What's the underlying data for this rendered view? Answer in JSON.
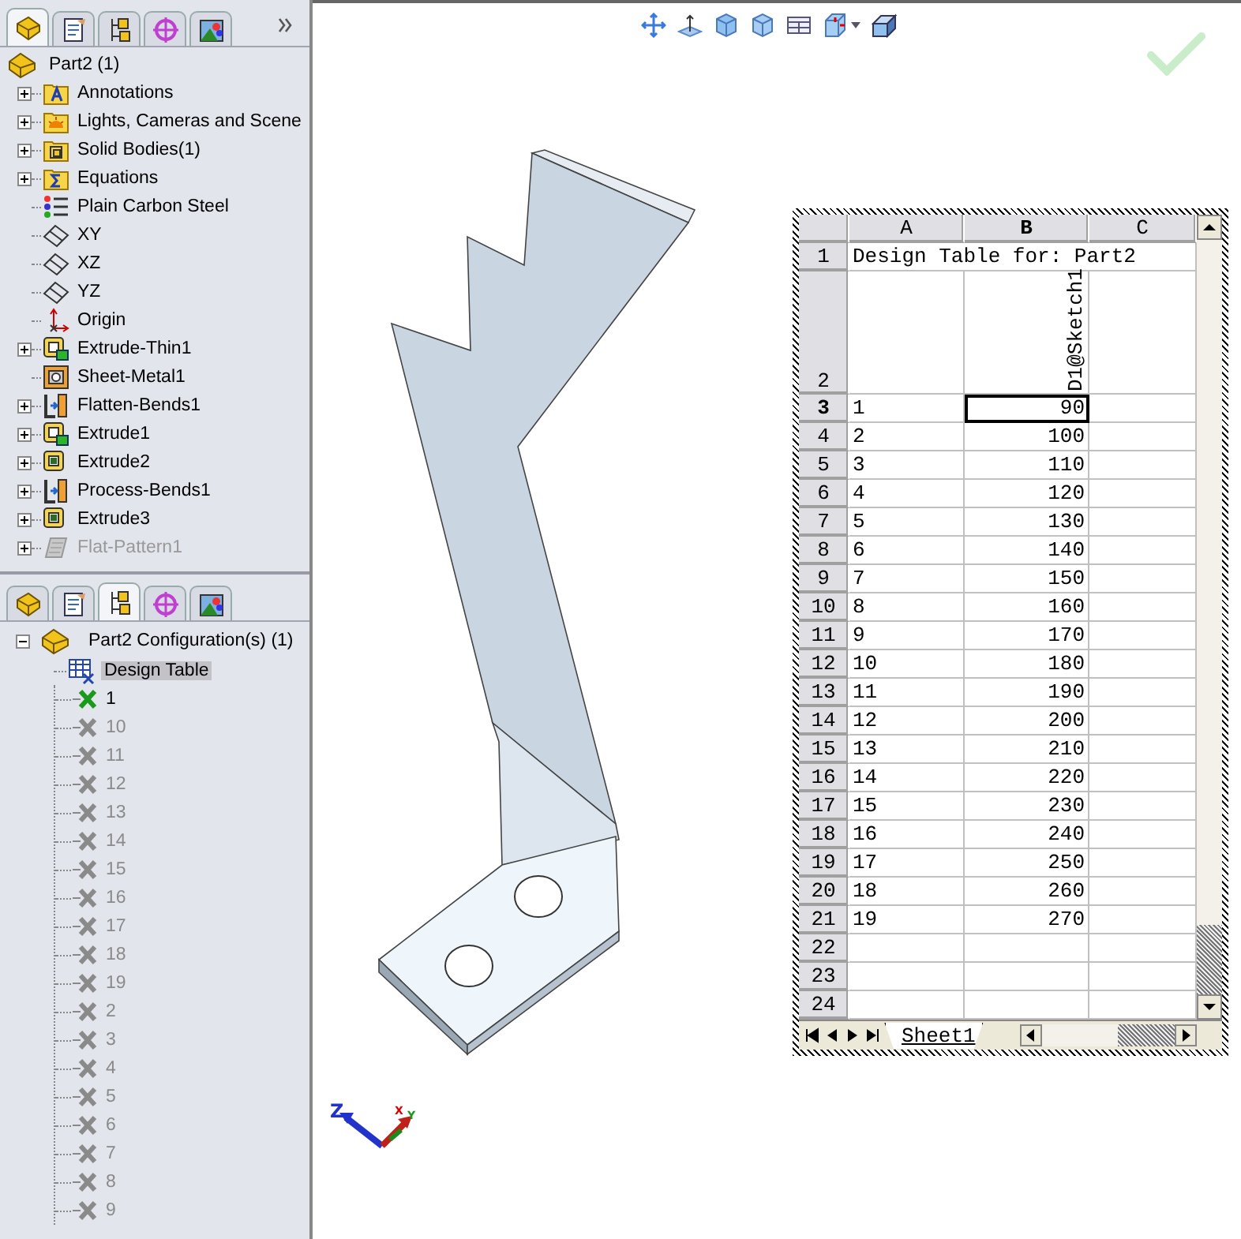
{
  "feature_tree": {
    "tabs": [
      {
        "kind": "part",
        "selected": true
      },
      {
        "kind": "property",
        "selected": false
      },
      {
        "kind": "config",
        "selected": false
      },
      {
        "kind": "target",
        "selected": false
      },
      {
        "kind": "display",
        "selected": false
      }
    ],
    "root": "Part2  (1)",
    "items": [
      {
        "label": "Annotations",
        "kind": "annotations",
        "expandable": true,
        "disabled": false
      },
      {
        "label": "Lights, Cameras and Scene",
        "kind": "lights",
        "expandable": true,
        "disabled": false
      },
      {
        "label": "Solid Bodies(1)",
        "kind": "bodies",
        "expandable": true,
        "disabled": false
      },
      {
        "label": "Equations",
        "kind": "equations",
        "expandable": true,
        "disabled": false
      },
      {
        "label": "Plain Carbon Steel",
        "kind": "material",
        "expandable": false,
        "disabled": false
      },
      {
        "label": "XY",
        "kind": "plane",
        "expandable": false,
        "disabled": false
      },
      {
        "label": "XZ",
        "kind": "plane",
        "expandable": false,
        "disabled": false
      },
      {
        "label": "YZ",
        "kind": "plane",
        "expandable": false,
        "disabled": false
      },
      {
        "label": "Origin",
        "kind": "origin",
        "expandable": false,
        "disabled": false
      },
      {
        "label": "Extrude-Thin1",
        "kind": "extrude",
        "expandable": true,
        "disabled": false
      },
      {
        "label": "Sheet-Metal1",
        "kind": "sheetmetal",
        "expandable": false,
        "disabled": false
      },
      {
        "label": "Flatten-Bends1",
        "kind": "bends",
        "expandable": true,
        "disabled": false
      },
      {
        "label": "Extrude1",
        "kind": "extrude",
        "expandable": true,
        "disabled": false
      },
      {
        "label": "Extrude2",
        "kind": "boss",
        "expandable": true,
        "disabled": false
      },
      {
        "label": "Process-Bends1",
        "kind": "bends",
        "expandable": true,
        "disabled": false
      },
      {
        "label": "Extrude3",
        "kind": "boss",
        "expandable": true,
        "disabled": false
      },
      {
        "label": "Flat-Pattern1",
        "kind": "flatpattern",
        "expandable": true,
        "disabled": true
      }
    ]
  },
  "config_manager": {
    "tabs": [
      {
        "kind": "part",
        "selected": false
      },
      {
        "kind": "property",
        "selected": false
      },
      {
        "kind": "config",
        "selected": true
      },
      {
        "kind": "target",
        "selected": false
      },
      {
        "kind": "display",
        "selected": false
      }
    ],
    "root": "Part2 Configuration(s)  (1)",
    "expanded": true,
    "design_table": {
      "label": "Design Table",
      "selected": true
    },
    "configurations": [
      {
        "label": "1",
        "active": true
      },
      {
        "label": "10",
        "active": false
      },
      {
        "label": "11",
        "active": false
      },
      {
        "label": "12",
        "active": false
      },
      {
        "label": "13",
        "active": false
      },
      {
        "label": "14",
        "active": false
      },
      {
        "label": "15",
        "active": false
      },
      {
        "label": "16",
        "active": false
      },
      {
        "label": "17",
        "active": false
      },
      {
        "label": "18",
        "active": false
      },
      {
        "label": "19",
        "active": false
      },
      {
        "label": "2",
        "active": false
      },
      {
        "label": "3",
        "active": false
      },
      {
        "label": "4",
        "active": false
      },
      {
        "label": "5",
        "active": false
      },
      {
        "label": "6",
        "active": false
      },
      {
        "label": "7",
        "active": false
      },
      {
        "label": "8",
        "active": false
      },
      {
        "label": "9",
        "active": false
      }
    ]
  },
  "triad": {
    "z": "Z",
    "x": "X",
    "y": "Y"
  },
  "spreadsheet": {
    "columns": [
      {
        "label": "A",
        "selected": false
      },
      {
        "label": "B",
        "selected": true
      },
      {
        "label": "C",
        "selected": false
      }
    ],
    "rows": [
      {
        "number": "1",
        "kind": "title",
        "a": "Design Table for: Part2",
        "selected": false
      },
      {
        "number": "2",
        "kind": "vertical",
        "b": "D1@Sketch1",
        "selected": false
      },
      {
        "number": "3",
        "kind": "value",
        "a": "1",
        "b": "90",
        "selected": true
      },
      {
        "number": "4",
        "kind": "value",
        "a": "2",
        "b": "100",
        "selected": false
      },
      {
        "number": "5",
        "kind": "value",
        "a": "3",
        "b": "110",
        "selected": false
      },
      {
        "number": "6",
        "kind": "value",
        "a": "4",
        "b": "120",
        "selected": false
      },
      {
        "number": "7",
        "kind": "value",
        "a": "5",
        "b": "130",
        "selected": false
      },
      {
        "number": "8",
        "kind": "value",
        "a": "6",
        "b": "140",
        "selected": false
      },
      {
        "number": "9",
        "kind": "value",
        "a": "7",
        "b": "150",
        "selected": false
      },
      {
        "number": "10",
        "kind": "value",
        "a": "8",
        "b": "160",
        "selected": false
      },
      {
        "number": "11",
        "kind": "value",
        "a": "9",
        "b": "170",
        "selected": false
      },
      {
        "number": "12",
        "kind": "value",
        "a": "10",
        "b": "180",
        "selected": false
      },
      {
        "number": "13",
        "kind": "value",
        "a": "11",
        "b": "190",
        "selected": false
      },
      {
        "number": "14",
        "kind": "value",
        "a": "12",
        "b": "200",
        "selected": false
      },
      {
        "number": "15",
        "kind": "value",
        "a": "13",
        "b": "210",
        "selected": false
      },
      {
        "number": "16",
        "kind": "value",
        "a": "14",
        "b": "220",
        "selected": false
      },
      {
        "number": "17",
        "kind": "value",
        "a": "15",
        "b": "230",
        "selected": false
      },
      {
        "number": "18",
        "kind": "value",
        "a": "16",
        "b": "240",
        "selected": false
      },
      {
        "number": "19",
        "kind": "value",
        "a": "17",
        "b": "250",
        "selected": false
      },
      {
        "number": "20",
        "kind": "value",
        "a": "18",
        "b": "260",
        "selected": false
      },
      {
        "number": "21",
        "kind": "value",
        "a": "19",
        "b": "270",
        "selected": false
      },
      {
        "number": "22",
        "kind": "value",
        "selected": false
      },
      {
        "number": "23",
        "kind": "value",
        "selected": false
      },
      {
        "number": "24",
        "kind": "value",
        "selected": false
      }
    ],
    "sheet_tabs": [
      {
        "label": "Sheet1",
        "selected": true
      }
    ]
  }
}
